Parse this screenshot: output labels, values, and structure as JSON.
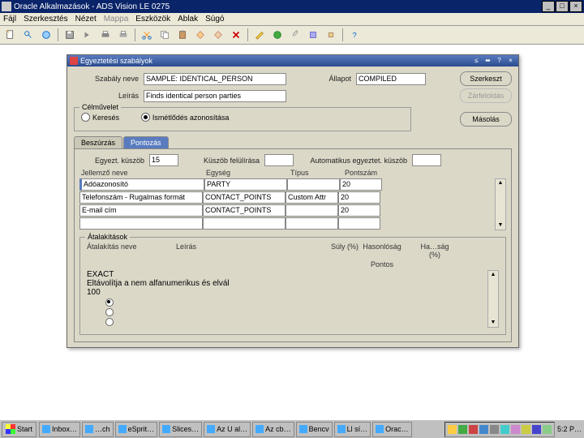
{
  "window": {
    "title": "Oracle Alkalmazások - ADS Vision LE 0275"
  },
  "menu": {
    "items": [
      "Fájl",
      "Szerkesztés",
      "Nézet",
      "Mappa",
      "Eszközök",
      "Ablak",
      "Súgó"
    ]
  },
  "modal": {
    "title": "Egyeztetési szabályok",
    "labels": {
      "szabaly_neve": "Szabály neve",
      "leiras": "Leírás",
      "allapot": "Állapot"
    },
    "fields": {
      "szabaly_neve": "SAMPLE: IDENTICAL_PERSON",
      "leiras": "Finds identical person parties",
      "allapot": "COMPILED"
    },
    "buttons": {
      "szerkeszt": "Szerkeszt",
      "zarfeloldas": "Zárfeloldás",
      "masolas": "Másolás"
    },
    "celmuvelet": {
      "legend": "Célművelet",
      "kereses": "Keresés",
      "ismetlodes": "Ismétlődés azonosítása"
    },
    "tabs": {
      "beszurzas": "Beszúrzás",
      "pontozas": "Pontozás"
    },
    "pontozas": {
      "egyezt_kuszob_lbl": "Egyezt. küszöb",
      "egyezt_kuszob": "15",
      "kuszob_felul_lbl": "Küszöb felülírása",
      "kuszob_felul": "",
      "auto_lbl": "Automatikus egyeztet. küszöb",
      "auto": ""
    },
    "grid": {
      "headers": {
        "jellemzo": "Jellemző neve",
        "egyseg": "Egység",
        "tipus": "Típus",
        "pontszam": "Pontszám"
      },
      "rows": [
        {
          "jellemzo": "Adóazonosító",
          "egyseg": "PARTY",
          "tipus": "",
          "pont": "20"
        },
        {
          "jellemzo": "Telefonszám - Rugalmas formát",
          "egyseg": "CONTACT_POINTS",
          "tipus": "Custom Attr",
          "pont": "20"
        },
        {
          "jellemzo": "E-mail cím",
          "egyseg": "CONTACT_POINTS",
          "tipus": "",
          "pont": "20"
        },
        {
          "jellemzo": "",
          "egyseg": "",
          "tipus": "",
          "pont": ""
        }
      ]
    },
    "atalakit": {
      "legend": "Átalakítások",
      "headers": {
        "neve": "Átalakítás neve",
        "leiras": "Leírás",
        "suly": "Súly (%)",
        "hasonlosag": "Hasonlóság",
        "pontos": "Pontos",
        "hason_pct": "Ha…ság (%)"
      },
      "rows": [
        {
          "neve": "EXACT",
          "leiras": "Eltávolítja a nem alfanumerikus és elvál",
          "suly": "100",
          "pontos": true
        },
        {
          "neve": "",
          "leiras": "",
          "suly": "",
          "pontos": false
        },
        {
          "neve": "",
          "leiras": "",
          "suly": "",
          "pontos": false
        }
      ]
    }
  },
  "taskbar": {
    "start": "Start",
    "tasks": [
      "Inbox…",
      "…ch",
      "eSprit…",
      "Slices…",
      "Az U al…",
      "Az cb…",
      "Bencv",
      "Ll sí…",
      "Orac…"
    ],
    "clock": "5:2 P…"
  }
}
